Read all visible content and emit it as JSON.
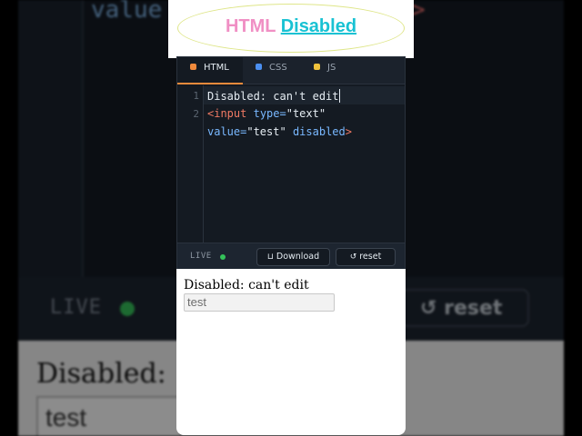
{
  "header": {
    "title_part1": "HTML",
    "title_part2": "Disabled"
  },
  "editor": {
    "tabs": [
      {
        "label": "HTML",
        "color": "#f08a3c",
        "active": true
      },
      {
        "label": "CSS",
        "color": "#4b8ff0",
        "active": false
      },
      {
        "label": "JS",
        "color": "#f0c23c",
        "active": false
      }
    ],
    "line_numbers": [
      "1",
      "2"
    ],
    "code": {
      "line1": "Disabled: can't edit",
      "line2_tag_open": "<input",
      "line2_attr1": "type=",
      "line2_val1": "\"text\"",
      "line3_attr2": "value=",
      "line3_val2": "\"test\"",
      "line3_attr3": "disabled",
      "line3_tag_close": ">"
    }
  },
  "statusbar": {
    "live_label": "LIVE",
    "download_label": "Download",
    "reset_label": "reset"
  },
  "preview": {
    "text": "Disabled: can't edit",
    "input_value": "test"
  },
  "background": {
    "code_fragment": "value",
    "code_fragment_right": ">",
    "live_label": "LIVE",
    "reset_label": "reset",
    "preview_text": "Disabled:",
    "preview_input": "test"
  }
}
